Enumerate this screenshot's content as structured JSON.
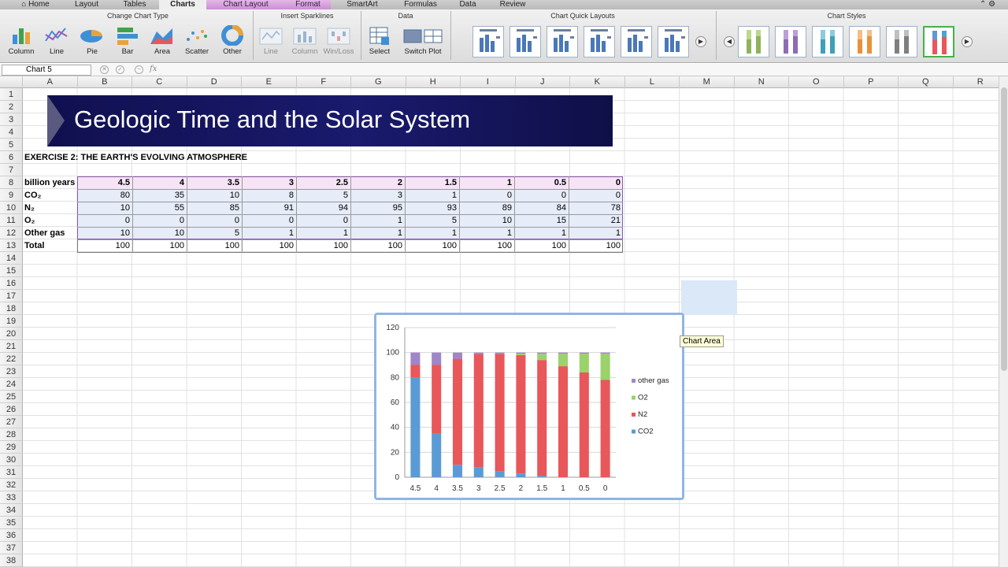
{
  "tabs": [
    "Home",
    "Layout",
    "Tables",
    "Charts",
    "Chart Layout",
    "Format",
    "SmartArt",
    "Formulas",
    "Data",
    "Review"
  ],
  "ribbon": {
    "groups": {
      "change_chart_type": "Change Chart Type",
      "insert_sparklines": "Insert Sparklines",
      "data": "Data",
      "quick_layouts": "Chart Quick Layouts",
      "styles": "Chart Styles"
    },
    "chart_types": [
      "Column",
      "Line",
      "Pie",
      "Bar",
      "Area",
      "Scatter",
      "Other"
    ],
    "sparklines": [
      "Line",
      "Column",
      "Win/Loss"
    ],
    "data_buttons": [
      "Select",
      "Switch Plot"
    ]
  },
  "formula_bar": {
    "name_box": "Chart 5",
    "fx": "fx"
  },
  "columns": [
    "A",
    "B",
    "C",
    "D",
    "E",
    "F",
    "G",
    "H",
    "I",
    "J",
    "K",
    "L",
    "M",
    "N",
    "O",
    "P",
    "Q",
    "R"
  ],
  "rows": [
    "1",
    "2",
    "3",
    "4",
    "5",
    "6",
    "7",
    "8",
    "9",
    "10",
    "11",
    "12",
    "13",
    "14",
    "15",
    "16",
    "17",
    "18",
    "19",
    "20",
    "21",
    "22",
    "23",
    "24",
    "25",
    "26",
    "27",
    "28",
    "29",
    "30",
    "31",
    "32",
    "33",
    "34",
    "35",
    "36",
    "37",
    "38"
  ],
  "banner_title": "Geologic Time and the Solar System",
  "exercise_title": "EXERCISE 2: THE EARTH'S EVOLVING ATMOSPHERE",
  "table": {
    "header_label": "billion years",
    "header": [
      "4.5",
      "4",
      "3.5",
      "3",
      "2.5",
      "2",
      "1.5",
      "1",
      "0.5",
      "0"
    ],
    "rows": [
      {
        "label": "CO₂",
        "values": [
          "80",
          "35",
          "10",
          "8",
          "5",
          "3",
          "1",
          "0",
          "0",
          "0"
        ]
      },
      {
        "label": "N₂",
        "values": [
          "10",
          "55",
          "85",
          "91",
          "94",
          "95",
          "93",
          "89",
          "84",
          "78"
        ]
      },
      {
        "label": "O₂",
        "values": [
          "0",
          "0",
          "0",
          "0",
          "0",
          "1",
          "5",
          "10",
          "15",
          "21"
        ]
      },
      {
        "label": "Other gas",
        "values": [
          "10",
          "10",
          "5",
          "1",
          "1",
          "1",
          "1",
          "1",
          "1",
          "1"
        ]
      },
      {
        "label": "Total",
        "values": [
          "100",
          "100",
          "100",
          "100",
          "100",
          "100",
          "100",
          "100",
          "100",
          "100"
        ]
      }
    ]
  },
  "tooltip": "Chart Area",
  "chart_data": {
    "type": "bar",
    "stacked": true,
    "categories": [
      "4.5",
      "4",
      "3.5",
      "3",
      "2.5",
      "2",
      "1.5",
      "1",
      "0.5",
      "0"
    ],
    "series": [
      {
        "name": "CO2",
        "color": "#5b9bd5",
        "values": [
          80,
          35,
          10,
          8,
          5,
          3,
          1,
          0,
          0,
          0
        ]
      },
      {
        "name": "N2",
        "color": "#e8575a",
        "values": [
          10,
          55,
          85,
          91,
          94,
          95,
          93,
          89,
          84,
          78
        ]
      },
      {
        "name": "O2",
        "color": "#9bd26a",
        "values": [
          0,
          0,
          0,
          0,
          0,
          1,
          5,
          10,
          15,
          21
        ]
      },
      {
        "name": "other gas",
        "color": "#9f86c8",
        "values": [
          10,
          10,
          5,
          1,
          1,
          1,
          1,
          1,
          1,
          1
        ]
      }
    ],
    "ylim": [
      0,
      120
    ],
    "yticks": [
      "0",
      "20",
      "40",
      "60",
      "80",
      "100",
      "120"
    ],
    "legend": "right",
    "grid": true
  }
}
